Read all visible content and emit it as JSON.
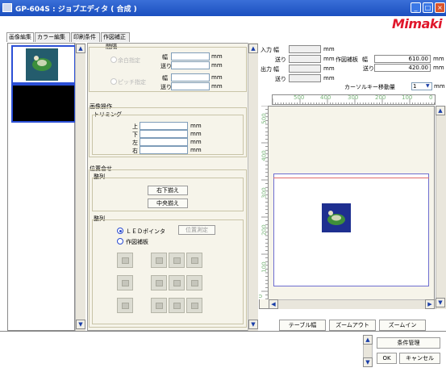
{
  "window": {
    "title": "GP-604S : ジョブエディタ ( 合成 )",
    "logo": "Mimaki"
  },
  "tabs": [
    {
      "label": "画像編集",
      "active": true
    },
    {
      "label": "カラー編集",
      "active": false
    },
    {
      "label": "印刷条件",
      "active": false
    },
    {
      "label": "作図補正",
      "active": false
    }
  ],
  "spacing": {
    "title": "間隔",
    "margin_label": "余白指定",
    "pitch_label": "ピッチ指定",
    "width_label": "幅",
    "feed_label": "送り",
    "unit": "mm"
  },
  "image_ops": {
    "title": "画像操作",
    "trimming": "トリミング",
    "top": "上",
    "bottom": "下",
    "left": "左",
    "right": "右",
    "unit": "mm"
  },
  "alignment": {
    "title": "位置合せ",
    "arrange1": "整列",
    "btn_bottom_right": "右下揃え",
    "btn_center": "中央揃え",
    "arrange2": "整列",
    "led_pointer": "ＬＥＤポインタ",
    "position_measure": "位置測定",
    "draw_correction": "作図補板"
  },
  "info": {
    "input_label": "入力",
    "output_label": "出力",
    "width_label": "幅",
    "feed_label": "送り",
    "unit": "mm",
    "draw_corr_label": "作図補板",
    "draw_width": "610.00",
    "draw_feed": "420.00"
  },
  "cursor": {
    "label": "カーソルキー移動量",
    "value": "1",
    "unit": "mm"
  },
  "ruler": {
    "top": [
      "500",
      "400",
      "300",
      "200",
      "100",
      "0"
    ],
    "left": [
      "500",
      "400",
      "300",
      "200",
      "100",
      "0"
    ]
  },
  "preview_buttons": {
    "table_width": "テーブル幅",
    "zoom_out": "ズームアウト",
    "zoom_in": "ズームイン"
  },
  "bottom_buttons": {
    "condition": "条件管理",
    "ok": "OK",
    "cancel": "キャンセル"
  },
  "colors": {
    "titlebar": "#1f55c8",
    "accent_blue": "#2b4fd6",
    "logo_red": "#e0162b",
    "panel_bg": "#f6f4ea"
  }
}
